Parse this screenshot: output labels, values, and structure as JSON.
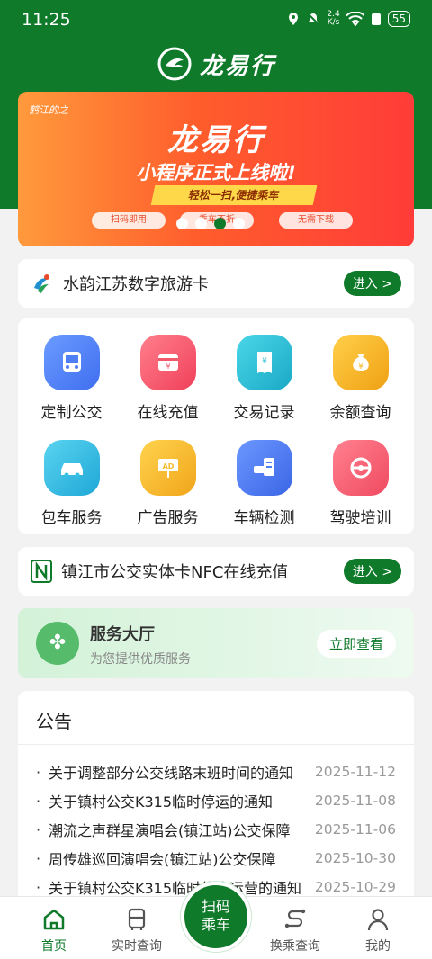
{
  "status": {
    "time": "11:25",
    "speed_value": "2.4",
    "speed_unit": "K/s",
    "battery": "55"
  },
  "app": {
    "name": "龙易行"
  },
  "banner": {
    "brand": "鹤江的之",
    "title": "龙易行",
    "subtitle": "小程序正式上线啦!",
    "slogan": "轻松一扫,便捷乘车",
    "tags": [
      "扫码即用",
      "乘车不折",
      "无需下载"
    ]
  },
  "travel_card": {
    "label": "水韵江苏数字旅游卡",
    "enter": "进入 >"
  },
  "services": [
    {
      "label": "定制公交",
      "icon": "bus-icon",
      "color": "#4f7ff5"
    },
    {
      "label": "在线充值",
      "icon": "wallet-card-icon",
      "color": "#f3596c"
    },
    {
      "label": "交易记录",
      "icon": "receipt-icon",
      "color": "#2dc0d8"
    },
    {
      "label": "余额查询",
      "icon": "money-bag-icon",
      "color": "#f3b623"
    },
    {
      "label": "包车服务",
      "icon": "car-icon",
      "color": "#35c0e5"
    },
    {
      "label": "广告服务",
      "icon": "ad-board-icon",
      "color": "#f6bc2c"
    },
    {
      "label": "车辆检测",
      "icon": "vehicle-check-icon",
      "color": "#4c7ff3"
    },
    {
      "label": "驾驶培训",
      "icon": "steering-wheel-icon",
      "color": "#f46173"
    }
  ],
  "nfc": {
    "label": "镇江市公交实体卡NFC在线充值",
    "enter": "进入 >"
  },
  "service_hall": {
    "title": "服务大厅",
    "subtitle": "为您提供优质服务",
    "button": "立即查看"
  },
  "notice": {
    "title": "公告",
    "items": [
      {
        "title": "关于调整部分公交线路末班时间的通知",
        "date": "2025-11-12"
      },
      {
        "title": "关于镇村公交K315临时停运的通知",
        "date": "2025-11-08"
      },
      {
        "title": "潮流之声群星演唱会(镇江站)公交保障",
        "date": "2025-11-06"
      },
      {
        "title": "周传雄巡回演唱会(镇江站)公交保障",
        "date": "2025-10-30"
      },
      {
        "title": "关于镇村公交K315临时停止运营的通知",
        "date": "2025-10-29"
      }
    ]
  },
  "tabs": {
    "home": "首页",
    "realtime": "实时查询",
    "scan_line1": "扫码",
    "scan_line2": "乘车",
    "transfer": "换乘查询",
    "mine": "我的"
  }
}
